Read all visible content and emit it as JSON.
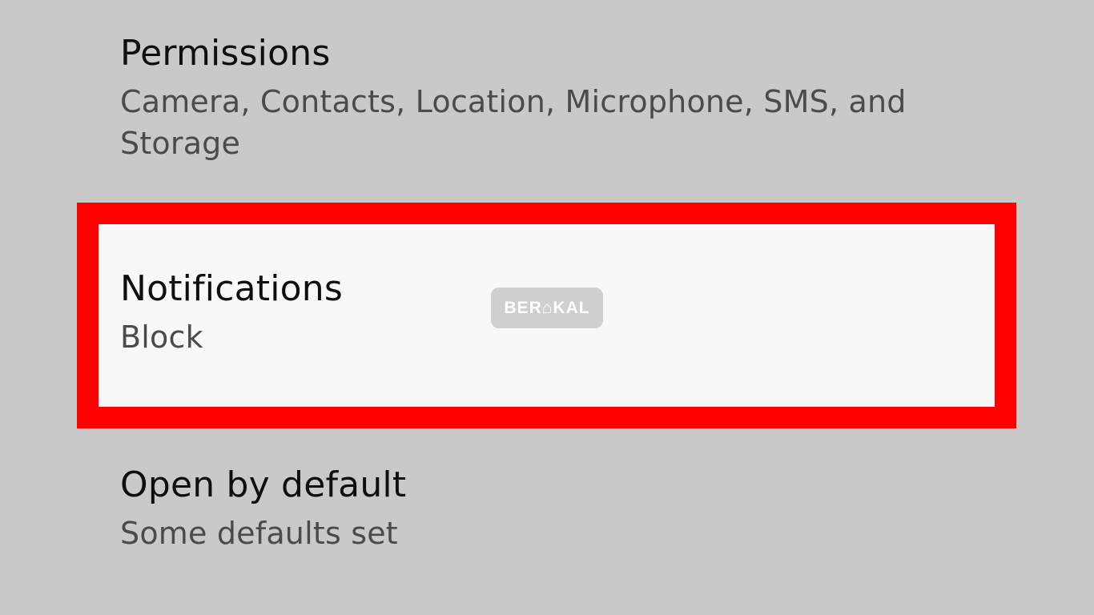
{
  "settings": {
    "permissions": {
      "title": "Permissions",
      "subtitle": "Camera, Contacts, Location, Microphone, SMS, and Storage"
    },
    "notifications": {
      "title": "Notifications",
      "subtitle": "Block"
    },
    "open_by_default": {
      "title": "Open by default",
      "subtitle": "Some defaults set"
    }
  },
  "highlight": {
    "color": "#ff0000"
  },
  "watermark": {
    "text": "BER⌂KAL"
  }
}
